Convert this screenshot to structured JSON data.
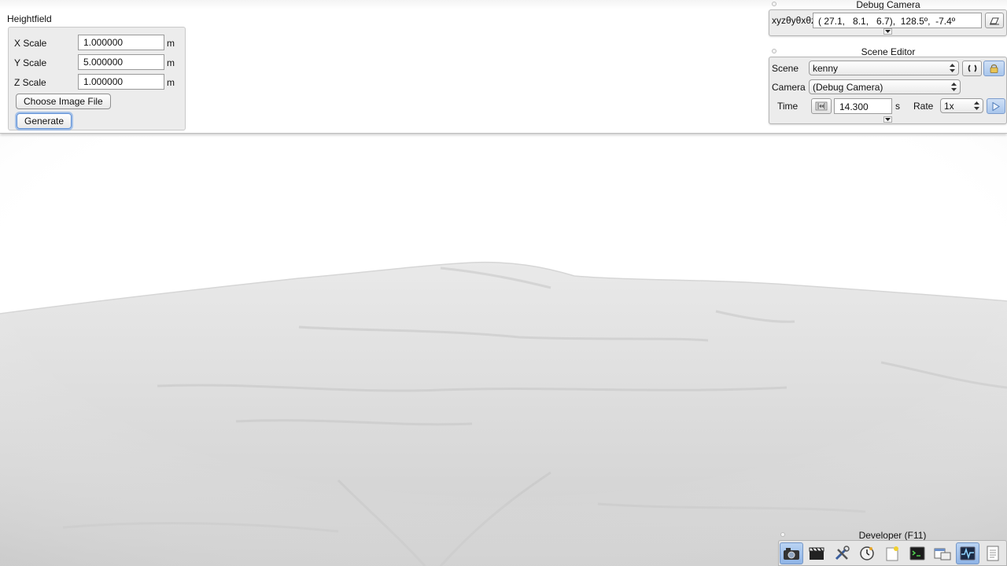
{
  "heightfield": {
    "title": "Heightfield",
    "rows": [
      {
        "label": "X Scale",
        "value": "1.000000",
        "unit": "m"
      },
      {
        "label": "Y Scale",
        "value": "5.000000",
        "unit": "m"
      },
      {
        "label": "Z Scale",
        "value": "1.000000",
        "unit": "m"
      }
    ],
    "choose_label": "Choose Image File",
    "generate_label": "Generate"
  },
  "debug_camera": {
    "title": "Debug Camera",
    "axis_label": "xyzθyθxθz",
    "value": "( 27.1,   8.1,   6.7),  128.5º,  -7.4º"
  },
  "scene_editor": {
    "title": "Scene Editor",
    "scene_label": "Scene",
    "scene_value": "kenny",
    "camera_label": "Camera",
    "camera_value": "(Debug Camera)",
    "time_label": "Time",
    "time_value": "14.300",
    "time_unit": "s",
    "rate_label": "Rate",
    "rate_value": "1x"
  },
  "developer": {
    "title": "Developer (F11)",
    "tools": [
      {
        "icon": "camera-icon"
      },
      {
        "icon": "clapperboard-icon"
      },
      {
        "icon": "tools-icon"
      },
      {
        "icon": "clock-icon"
      },
      {
        "icon": "note-icon"
      },
      {
        "icon": "console-icon"
      },
      {
        "icon": "window-icon"
      },
      {
        "icon": "profiler-icon"
      },
      {
        "icon": "document-icon"
      }
    ]
  },
  "colors": {
    "panel_bg": "#ececec",
    "accent_blue": "#5d8fd6",
    "terrain": "#e2e2e2"
  }
}
